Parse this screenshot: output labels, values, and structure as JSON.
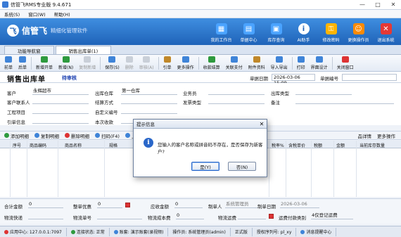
{
  "window": {
    "title": "信管飞RMS专业版 9.4.671",
    "min": "—",
    "max": "□",
    "close": "✕"
  },
  "menu": [
    "系统(S)",
    "窗口(W)",
    "帮助(H)"
  ],
  "brand": {
    "mark": "飞",
    "name": "信管飞",
    "slogan": "精细化管理软件"
  },
  "tools": [
    {
      "label": "我的工作台",
      "icon": "workbench-icon",
      "color": "#4aa3ff",
      "glyph": "▦"
    },
    {
      "label": "单据中心",
      "icon": "document-center-icon",
      "color": "#4aa3ff",
      "glyph": "▤"
    },
    {
      "label": "库存查询",
      "icon": "inventory-icon",
      "color": "#4aa3ff",
      "glyph": "▣"
    },
    {
      "label": "AI助手",
      "icon": "ai-assistant-icon",
      "color": "#ffffff",
      "glyph": "i"
    },
    {
      "label": "修改密码",
      "icon": "lock-icon",
      "color": "#ffb400",
      "glyph": "⚿"
    },
    {
      "label": "更换操作员",
      "icon": "switch-user-icon",
      "color": "#ff8a00",
      "glyph": "☺"
    },
    {
      "label": "退出系统",
      "icon": "exit-icon",
      "color": "#e53935",
      "glyph": "✕"
    }
  ],
  "tabs": [
    {
      "label": "功能导航窗"
    },
    {
      "label": "销售出库单(1)"
    }
  ],
  "toolbar": [
    {
      "label": "前单",
      "color": "#3f84d8",
      "disabled": false
    },
    {
      "label": "后单",
      "color": "#3f84d8",
      "disabled": false
    },
    {
      "sep": true
    },
    {
      "label": "新增开单",
      "color": "#2e9a3e",
      "disabled": false
    },
    {
      "label": "新增(N)",
      "color": "#2e9a3e",
      "disabled": false
    },
    {
      "label": "复制新增",
      "color": "#888",
      "disabled": true
    },
    {
      "sep": true
    },
    {
      "label": "保存(S)",
      "color": "#3f84d8",
      "disabled": false
    },
    {
      "label": "删除",
      "color": "#888",
      "disabled": true
    },
    {
      "label": "审核(A)",
      "color": "#888",
      "disabled": true
    },
    {
      "sep": true
    },
    {
      "label": "引单",
      "color": "#c0882a",
      "disabled": false
    },
    {
      "label": "更多操作",
      "color": "#3f84d8",
      "disabled": false
    },
    {
      "sep": true
    },
    {
      "label": "收款结算",
      "color": "#2e9a3e",
      "disabled": false
    },
    {
      "label": "关联支付",
      "color": "#3f84d8",
      "disabled": false
    },
    {
      "label": "附件资料",
      "color": "#c0882a",
      "disabled": false
    },
    {
      "label": "导入导出",
      "color": "#3f84d8",
      "disabled": false
    },
    {
      "sep": true
    },
    {
      "label": "打印",
      "color": "#3f84d8",
      "disabled": false
    },
    {
      "label": "界面设计",
      "color": "#3f84d8",
      "disabled": false
    },
    {
      "sep": true
    },
    {
      "label": "关闭窗口",
      "color": "#d33",
      "disabled": false
    }
  ],
  "doc": {
    "title": "销售出库单",
    "status": "待审核",
    "date_label": "单据日期",
    "date_value": "2026-03-06 15:09",
    "number_label": "单据编号",
    "number_value": ""
  },
  "form": {
    "customer_label": "客户",
    "customer_value": "永辉超市",
    "warehouse_label": "出库仓库",
    "warehouse_value": "第一仓库",
    "salesman_label": "业务员",
    "salesman_value": "",
    "out_type_label": "出库类型",
    "out_type_value": "",
    "contact_label": "客户联系人",
    "contact_value": "",
    "settle_label": "结算方式",
    "settle_value": "",
    "invoice_label": "发票类型",
    "invoice_value": "",
    "remark_label": "备注",
    "remark_value": "",
    "project_label": "工程项目",
    "project_value": "",
    "custom_label": "自定义编号",
    "custom_value": "",
    "ref_label": "引单信息",
    "ref_value": "",
    "receive_label": "本次收款",
    "receive_value": ""
  },
  "gridbar": [
    {
      "label": "添加明细",
      "color": "#2e9a3e"
    },
    {
      "label": "复制明细",
      "color": "#3f84d8"
    },
    {
      "label": "删除明细",
      "color": "#d33"
    },
    {
      "label": "扫码(F4)",
      "color": "#3f84d8"
    },
    {
      "label": "上移",
      "color": "#3f84d8"
    }
  ],
  "gridbar_right": [
    {
      "label": "品详情"
    },
    {
      "label": "更多操作"
    }
  ],
  "grid": {
    "headers": [
      "序号",
      "商品编码",
      "商品名称",
      "规格",
      "税率%",
      "含税单价",
      "税额",
      "金额",
      "当前库存数量"
    ]
  },
  "footer": {
    "total_label": "合计金额",
    "total_value": "0",
    "discount_label": "整单优惠",
    "discount_value": "0",
    "receivable_label": "应收金额",
    "receivable_value": "0",
    "operator_label": "制单人",
    "operator_value": "系统管理员",
    "make_date_label": "制单日期",
    "make_date_value": "2026-03-06",
    "express_label": "物流快递",
    "express_value": "",
    "tracking_label": "物流单号",
    "tracking_value": "",
    "cost_label": "物流成本费",
    "cost_value": "0",
    "freight_label": "物流运费",
    "freight_value": "",
    "freight_type_label": "运费付款类别",
    "freight_type_value": "4仅登记运费"
  },
  "status": [
    {
      "label": "应用中心: 127.0.0.1:7097",
      "dot": "#d33"
    },
    {
      "label": "连接状态: 正常",
      "dot": "#2e9a3e"
    },
    {
      "label": "账套: 演示账套(录视频)",
      "dot": "#3f84d8"
    },
    {
      "label": "操作员: 系统管理员(admin)",
      "dot": ""
    },
    {
      "label": "正式版",
      "dot": ""
    },
    {
      "label": "授权序列号: pl_xy",
      "dot": ""
    },
    {
      "label": "消息提醒中心",
      "dot": "#3f84d8"
    }
  ],
  "dialog": {
    "title": "提示信息",
    "close": "✕",
    "icon_glyph": "i",
    "message": "您输入的客户名称或拼音码不存在，是否保存为新客户?",
    "yes": "是(Y)",
    "no": "否(N)"
  }
}
